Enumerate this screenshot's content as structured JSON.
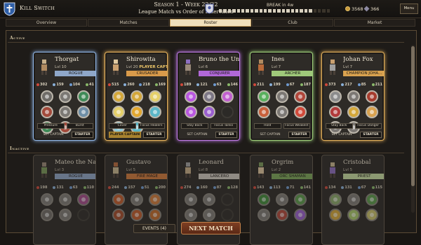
{
  "header": {
    "team_name": "Kill Switch",
    "season": "Season 1 - Week 22/32",
    "match": "League Match vs Order of Innervision",
    "break_label": "BREAK in 4w",
    "break_progress_segments": 25,
    "break_progress_filled": 21,
    "gold": "3568",
    "gems": "366",
    "menu_label": "Menu",
    "team_logo_icon": "shield-crest-icon",
    "opponent_logo_icon": "opponent-crest-icon"
  },
  "tabs": [
    {
      "label": "Overview"
    },
    {
      "label": "Matches"
    },
    {
      "label": "Roster",
      "active": true
    },
    {
      "label": "Club"
    },
    {
      "label": "Market"
    }
  ],
  "sections": {
    "active": "Active",
    "inactive": "Inactive"
  },
  "stat_icons": [
    "heart-icon",
    "sword-icon",
    "shield-icon",
    "boot-icon"
  ],
  "active_players": [
    {
      "name": "Thorgat",
      "level": "Lvl 10",
      "captain_tag": "",
      "class": "ROGUE",
      "class_color": "#8fa7c9",
      "frame_color": "#8fb5e6",
      "stats": [
        "302",
        "159",
        "104",
        "41"
      ],
      "skills": [
        "#6f6c68",
        "#7b7874",
        "#3f8a57",
        "#a34a3b",
        "#7b7874",
        "#6e8ea6",
        "#3f8a57",
        "#a34a3b"
      ],
      "tactics": [
        "Pressure",
        "Burst"
      ],
      "captain_label": "SET CAPTAIN",
      "is_captain": false,
      "starter_label": "STARTER"
    },
    {
      "name": "Shirowita",
      "level": "Lvl 20",
      "captain_tag": "PLAYER CAPTAIN",
      "class": "CRUSADER",
      "class_color": "#d89a4a",
      "frame_color": "#e7b35c",
      "stats": [
        "515",
        "260",
        "218",
        "169"
      ],
      "skills": [
        "#d4a73a",
        "#d4a73a",
        "#e5d06a",
        "#e5d06a",
        "#e3a72e",
        "#5cb6c7",
        "#8ec7d6",
        "#5cb6c7"
      ],
      "tactics": [
        "Cover",
        "Focus Healers"
      ],
      "captain_label": "PLAYER CAPTAIN",
      "is_captain": true,
      "starter_label": "STARTER"
    },
    {
      "name": "Bruno the Un...",
      "level": "Lvl 6",
      "captain_tag": "",
      "class": "CONJURER",
      "class_color": "#b168d8",
      "frame_color": "#c07ae8",
      "stats": [
        "189",
        "121",
        "63",
        "146"
      ],
      "skills": [
        "#b957e0",
        "#7c7785",
        "#c25fd0",
        "#b957e0",
        "#9a5fcf",
        "empty"
      ],
      "tactics": [
        "Stay Back",
        "Focus Tanks"
      ],
      "captain_label": "SET CAPTAIN",
      "is_captain": false,
      "starter_label": "STARTER"
    },
    {
      "name": "Ines",
      "level": "Lvl 7",
      "captain_tag": "",
      "class": "ARCHER",
      "class_color": "#9fc97a",
      "frame_color": "#9ed07a",
      "stats": [
        "211",
        "199",
        "67",
        "187"
      ],
      "skills": [
        "#58b05d",
        "#7c7874",
        "#b0463a",
        "#c9603b",
        "#7c7874",
        "#d14a3a"
      ],
      "tactics": [
        "Hold",
        "Focus Weakest"
      ],
      "captain_label": "SET CAPTAIN",
      "is_captain": false,
      "starter_label": "STARTER"
    },
    {
      "name": "Johan Fox",
      "level": "Lvl 7",
      "captain_tag": "",
      "class": "CHAMPION JOHA...",
      "class_color": "#d9a24f",
      "frame_color": "#e3b05a",
      "stats": [
        "373",
        "217",
        "85",
        "211"
      ],
      "skills": [
        "#8c8c8c",
        "#7c7874",
        "#a63c2e",
        "#b23a3a",
        "#d4a73a",
        "#d9a24f",
        "#7c7874",
        "#7c7874"
      ],
      "tactics": [
        "Stay Back",
        "Focus Danger"
      ],
      "captain_label": "SET CAPTAIN",
      "is_captain": false,
      "starter_label": "STARTER"
    }
  ],
  "inactive_players": [
    {
      "name": "Mateo the Na...",
      "level": "Lvl 3",
      "class": "ROGUE",
      "class_color": "#8fa7c9",
      "stats": [
        "198",
        "131",
        "63",
        "110"
      ],
      "skills": [
        "#7c7874",
        "#7c7874",
        "#a34a8b",
        "#6e6a66",
        "#7c7874",
        "empty"
      ]
    },
    {
      "name": "Gustavo",
      "level": "Lvl 5",
      "class": "FIRE MAGE",
      "class_color": "#d07a3a",
      "stats": [
        "244",
        "157",
        "51",
        "200"
      ],
      "skills": [
        "#c05a2a",
        "#7c7874",
        "#d07a3a",
        "#a24a2a",
        "#c05a2a",
        "#c06a2a"
      ]
    },
    {
      "name": "Leonard",
      "level": "Lvl 8",
      "class": "LANCERO",
      "class_color": "#cfcac0",
      "stats": [
        "274",
        "160",
        "87",
        "128"
      ],
      "skills": [
        "#7c7874",
        "#7c7874",
        "empty",
        "#7c7874",
        "#7c7874",
        "empty"
      ]
    },
    {
      "name": "Orgrim",
      "level": "Lvl 2",
      "class": "ORC SHAMAN",
      "class_color": "#7ba85a",
      "stats": [
        "143",
        "113",
        "71",
        "141"
      ],
      "skills": [
        "#3f8a3a",
        "#7c7874",
        "#5a9a4a",
        "#7c7874",
        "#b0463a",
        "#9a5fcf"
      ]
    },
    {
      "name": "Cristobal",
      "level": "Lvl 5",
      "class": "PRIEST",
      "class_color": "#c9e0a4",
      "stats": [
        "134",
        "131",
        "67",
        "115"
      ],
      "skills": [
        "#8aa86a",
        "#7c7874",
        "#5a9a4a",
        "#d4a73a",
        "#a9c96a",
        "#c9c06a"
      ]
    }
  ],
  "footer": {
    "events_label": "EVENTS (4)",
    "next_match_label": "NEXT MATCH"
  }
}
